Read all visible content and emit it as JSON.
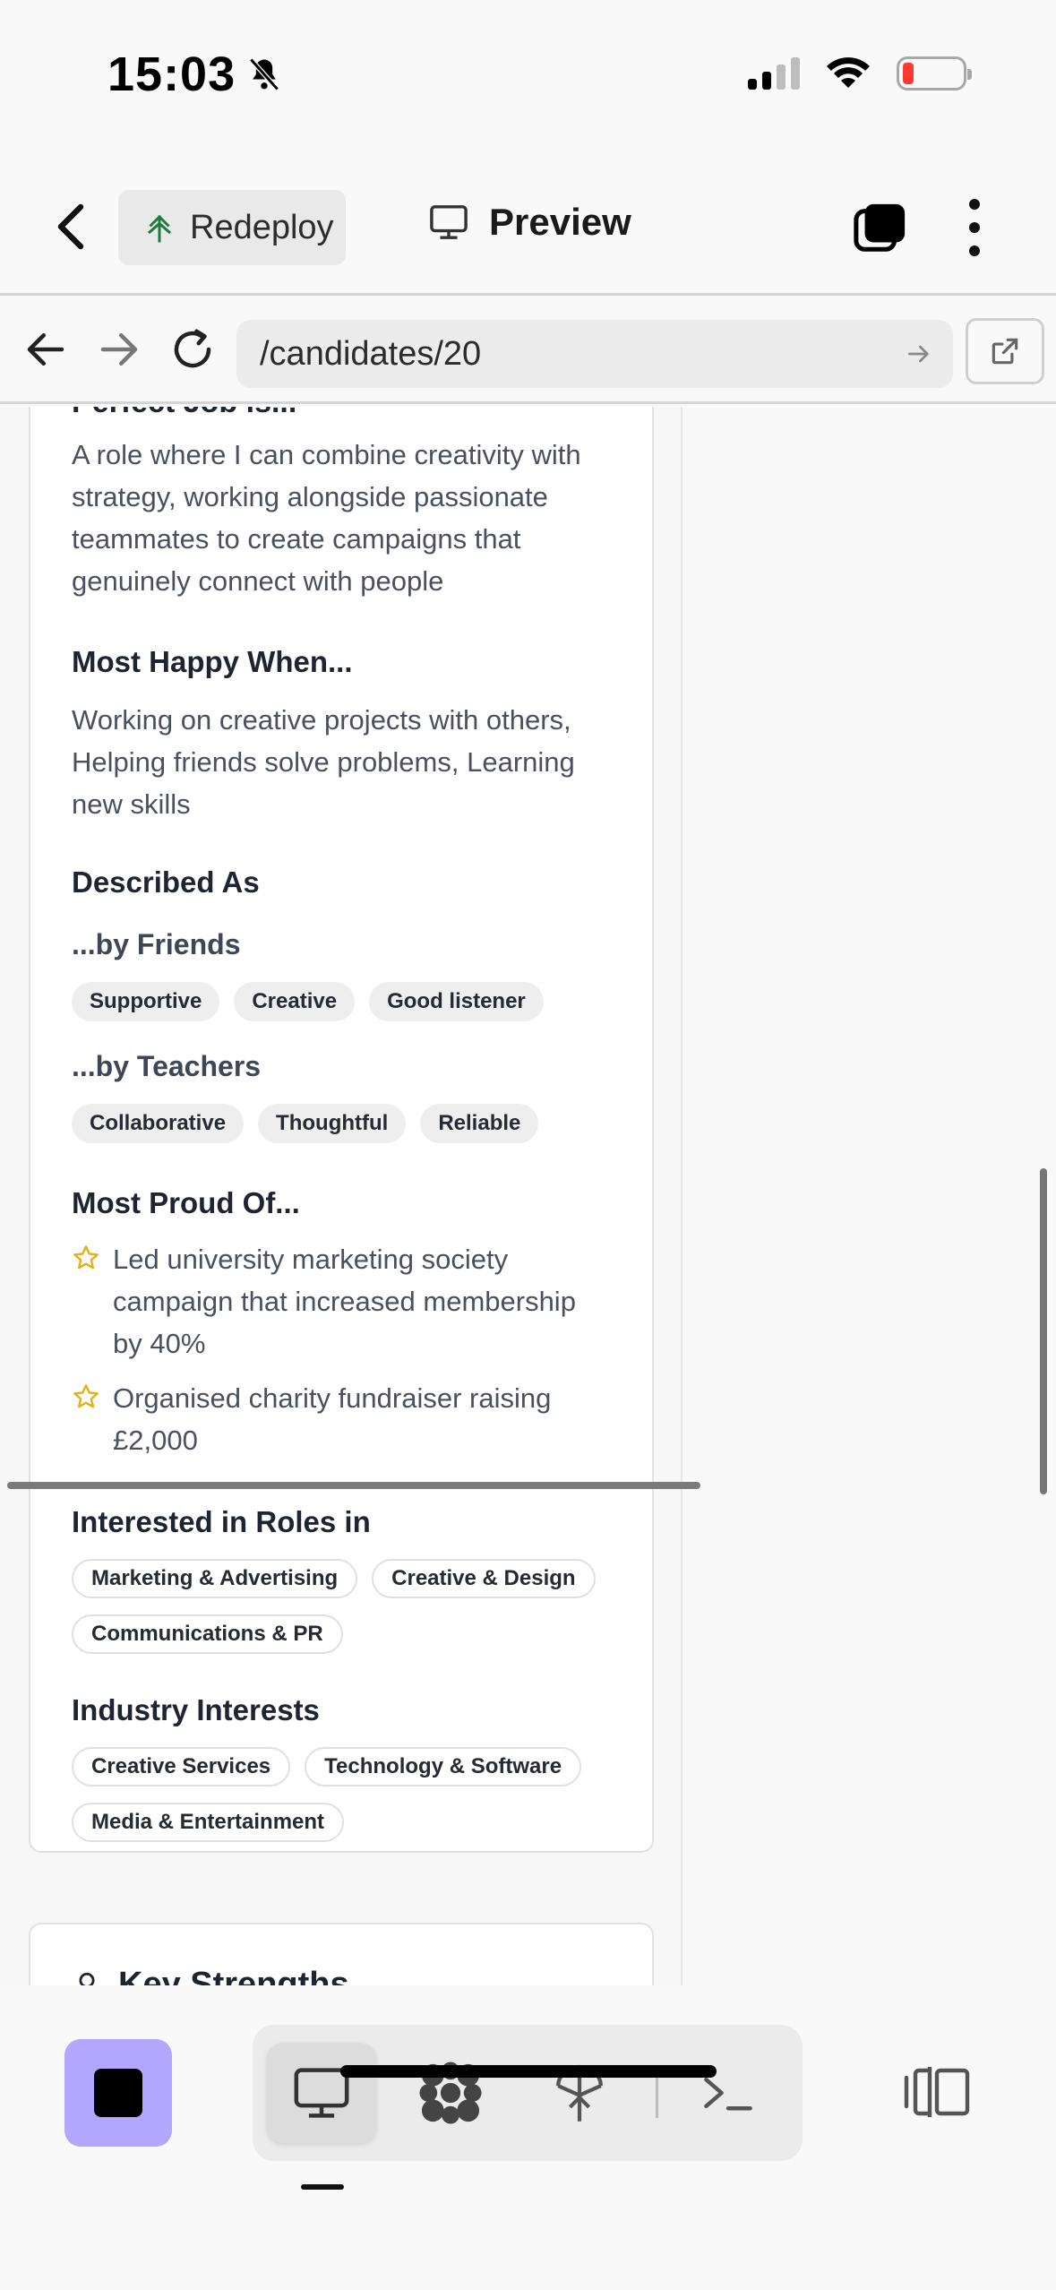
{
  "status_bar": {
    "time": "15:03",
    "icons": [
      "bell-slash-icon",
      "cellular-signal-icon",
      "wifi-icon",
      "battery-low-icon"
    ],
    "battery_color": "#ff3b30"
  },
  "toolbar": {
    "redeploy_label": "Redeploy",
    "preview_label": "Preview",
    "icons": [
      "back-chevron-icon",
      "redeploy-tree-icon",
      "monitor-icon",
      "tabs-icon",
      "more-vertical-icon"
    ]
  },
  "browser": {
    "url": "/candidates/20",
    "icons": [
      "back-arrow-icon",
      "forward-arrow-icon",
      "reload-icon",
      "go-arrow-icon",
      "external-link-icon"
    ]
  },
  "profile": {
    "cut_heading": "Perfect Job is...",
    "perfect_job": "A role where I can combine creativity with strategy, working alongside passionate teammates to create campaigns that genuinely connect with people",
    "happy_heading": "Most Happy When...",
    "happy_text": "Working on creative projects with others, Helping friends solve problems, Learning new skills",
    "described_heading": "Described As",
    "friends_label": "...by Friends",
    "friends_tags": [
      "Supportive",
      "Creative",
      "Good listener"
    ],
    "teachers_label": "...by Teachers",
    "teachers_tags": [
      "Collaborative",
      "Thoughtful",
      "Reliable"
    ],
    "proud_heading": "Most Proud Of...",
    "proud_items": [
      "Led university marketing society campaign that increased membership by 40%",
      "Organised charity fundraiser raising £2,000"
    ],
    "roles_heading": "Interested in Roles in",
    "roles_tags": [
      "Marketing & Advertising",
      "Creative & Design",
      "Communications & PR"
    ],
    "industry_heading": "Industry Interests",
    "industry_tags": [
      "Creative Services",
      "Technology & Software",
      "Media & Entertainment"
    ],
    "next_heading": "Key Strengths",
    "accent_star": "#e5b016"
  },
  "bottom_bar": {
    "stop_color": "#b3a6ff",
    "tools": [
      "monitor-icon",
      "dots-grid-icon",
      "deploy-tree-icon",
      "terminal-icon"
    ],
    "split_view_icon": "split-view-icon"
  }
}
